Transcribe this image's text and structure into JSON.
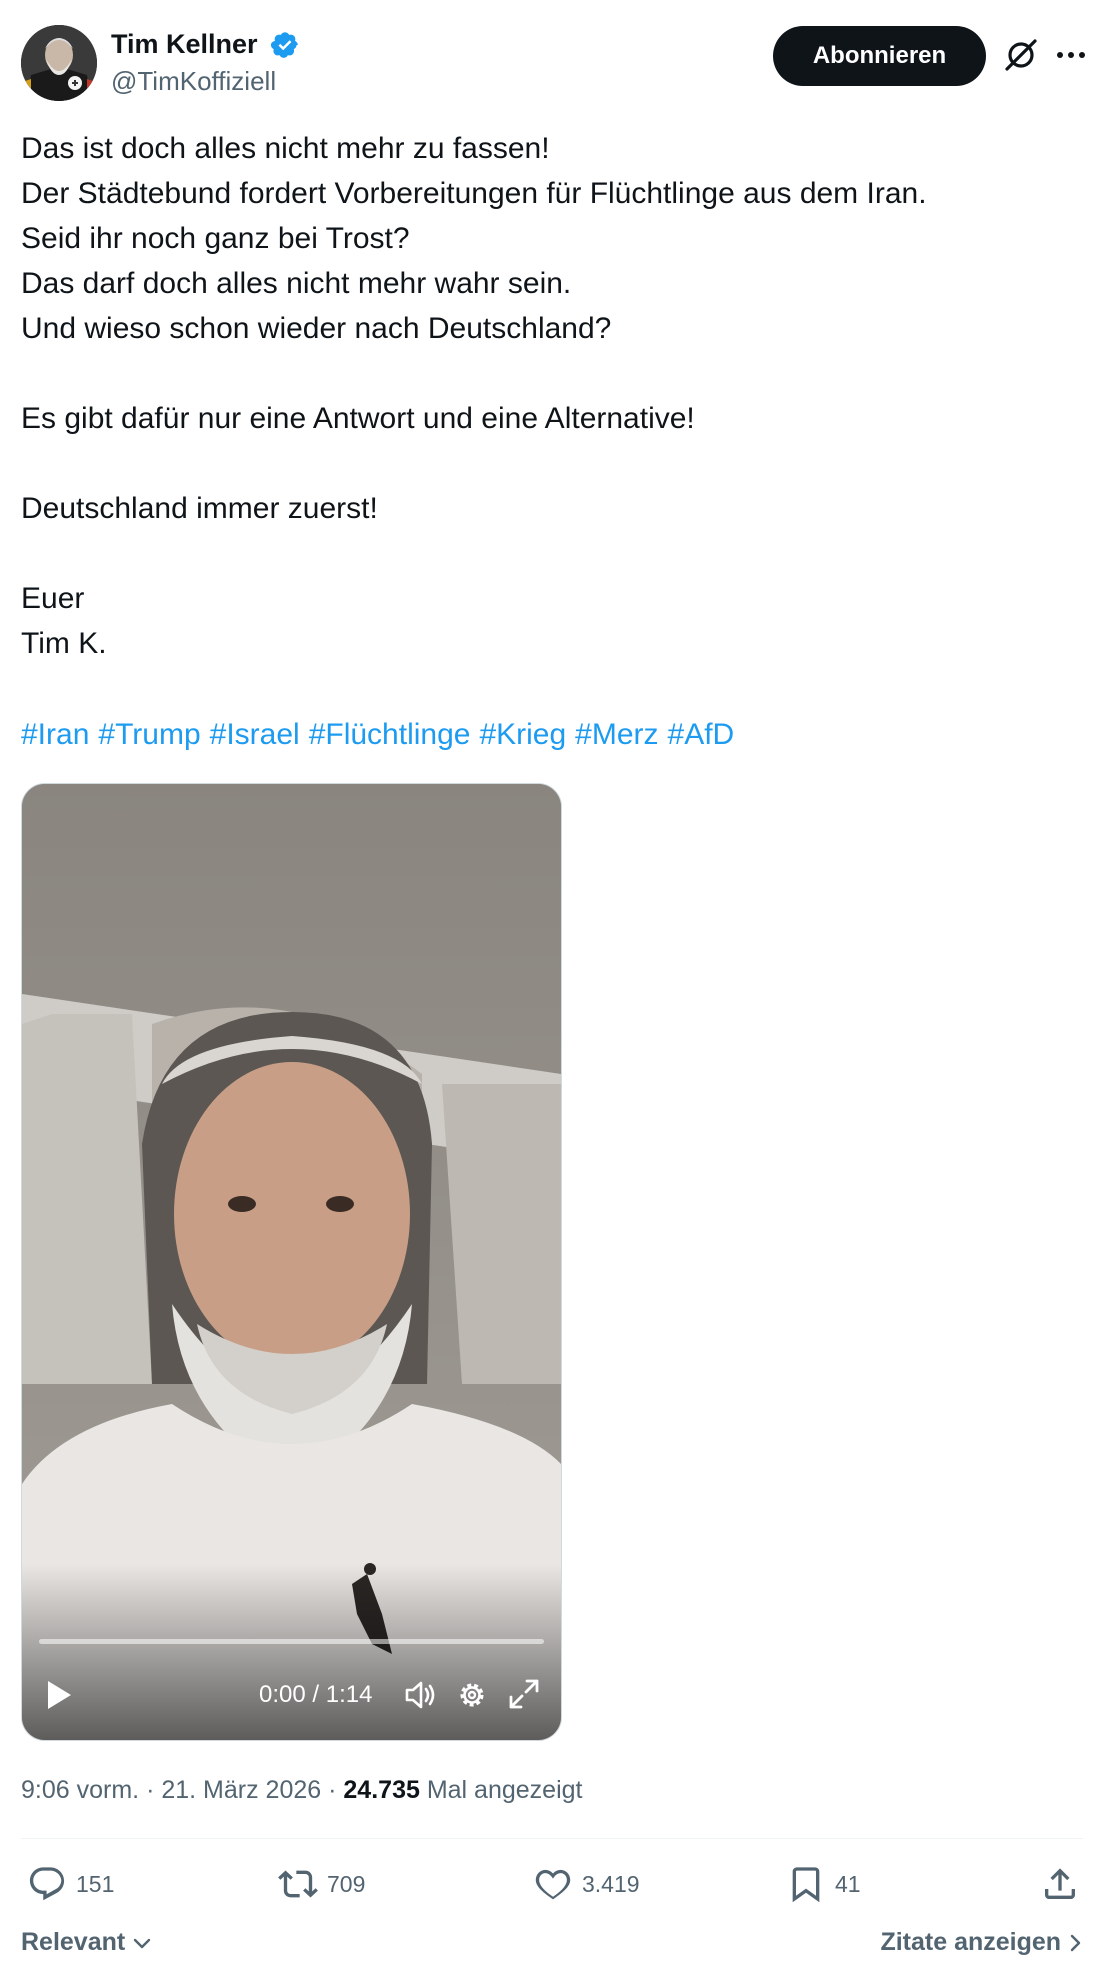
{
  "author": {
    "display_name": "Tim Kellner",
    "handle": "@TimKoffiziell",
    "verified": true
  },
  "header": {
    "subscribe_label": "Abonnieren"
  },
  "tweet": {
    "text": "Das ist doch alles nicht mehr zu fassen!\nDer Städtebund fordert Vorbereitungen für Flüchtlinge aus dem Iran.\nSeid ihr noch ganz bei Trost?\nDas darf doch alles nicht mehr wahr sein.\nUnd wieso schon wieder nach Deutschland?\n\nEs gibt dafür nur eine Antwort und eine Alternative!\n\nDeutschland immer zuerst!\n\nEuer\nTim K.",
    "hashtags": [
      "#Iran",
      "#Trump",
      "#Israel",
      "#Flüchtlinge",
      "#Krieg",
      "#Merz",
      "#AfD"
    ]
  },
  "video": {
    "time_display": "0:00 / 1:14",
    "progress": 0.0
  },
  "meta": {
    "time": "9:06 vorm.",
    "date": "21. März 2026",
    "views": "24.735",
    "views_suffix": "Mal angezeigt",
    "separator": "·"
  },
  "actions": {
    "replies": "151",
    "retweets": "709",
    "likes": "3.419",
    "bookmarks": "41"
  },
  "footer": {
    "sort_label": "Relevant",
    "quotes_label": "Zitate anzeigen"
  },
  "colors": {
    "accent": "#1d9bf0",
    "text_primary": "#0f1419",
    "text_secondary": "#536471"
  }
}
